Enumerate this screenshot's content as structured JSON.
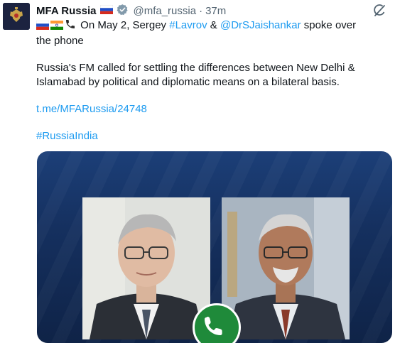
{
  "author": {
    "name": "MFA Russia",
    "handle": "@mfa_russia",
    "separator": "·",
    "time": "37m",
    "name_flag": "russia-flag-icon",
    "verified_icon": "verified-badge-icon"
  },
  "tweet": {
    "line1_lead": "On May 2, Sergey",
    "mention_lavrov": "#Lavrov",
    "amp": "&",
    "mention_jaishankar": "@DrSJaishankar",
    "line1_tail": "spoke over the phone",
    "paragraph2": "Russia's FM called for settling the differences between New Delhi & Islamabad by political and diplomatic means on a bilateral basis.",
    "link": "t.me/MFARussia/24748",
    "hashtag": "#RussiaIndia",
    "emojis": [
      "russia-flag-icon",
      "india-flag-icon",
      "telephone-icon"
    ]
  },
  "colors": {
    "link": "#1d9bf0",
    "card_bg": "#15305f",
    "phone_green": "#1f8a3a"
  }
}
